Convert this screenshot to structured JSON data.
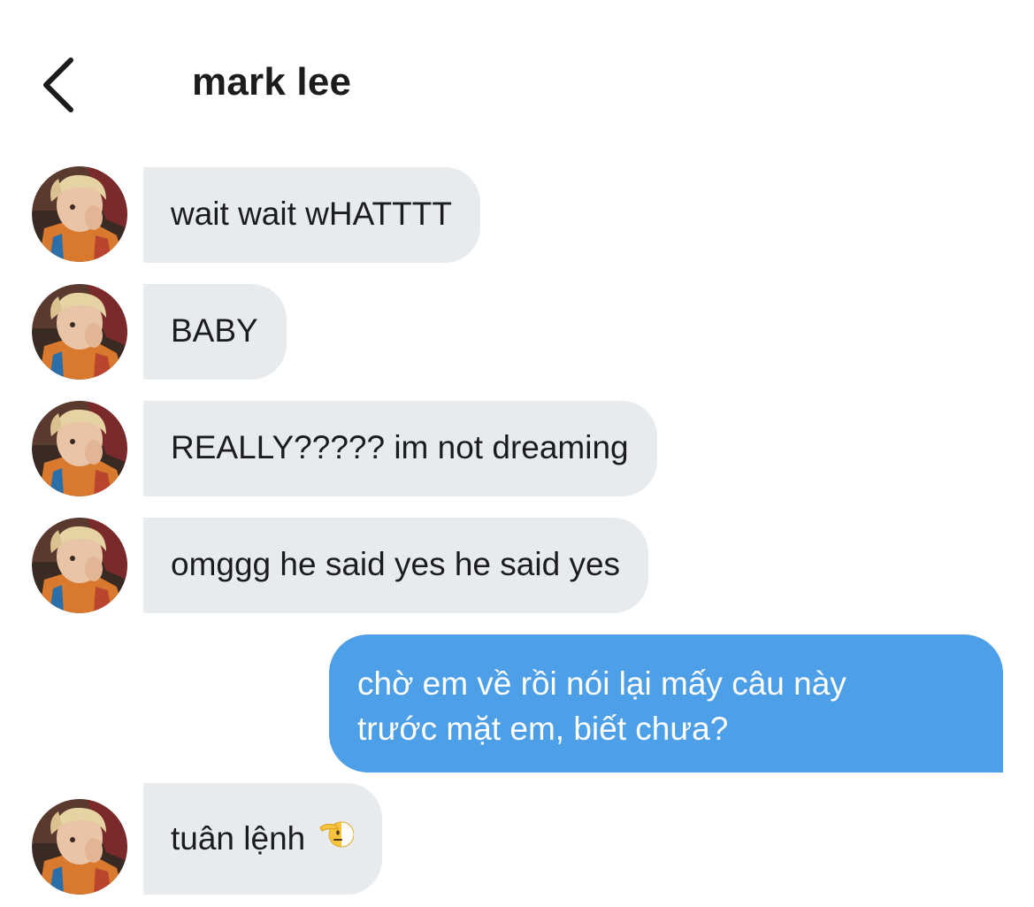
{
  "header": {
    "title": "mark lee",
    "back_icon": "chevron-left-icon"
  },
  "messages": [
    {
      "sender": "them",
      "text": "wait wait wHATTTT"
    },
    {
      "sender": "them",
      "text": "BABY"
    },
    {
      "sender": "them",
      "text": "REALLY????? im not dreaming"
    },
    {
      "sender": "them",
      "text": "omggg he said yes he said yes"
    },
    {
      "sender": "me",
      "lines": [
        "chờ em về rồi nói lại mấy câu này",
        "trước mặt em, biết chưa?"
      ]
    },
    {
      "sender": "them",
      "text": "tuân lệnh",
      "emoji": "saluting-face-icon"
    }
  ],
  "colors": {
    "incoming_bubble": "#e8ebee",
    "outgoing_bubble": "#4d9fe8",
    "text": "#1c1c1e"
  }
}
